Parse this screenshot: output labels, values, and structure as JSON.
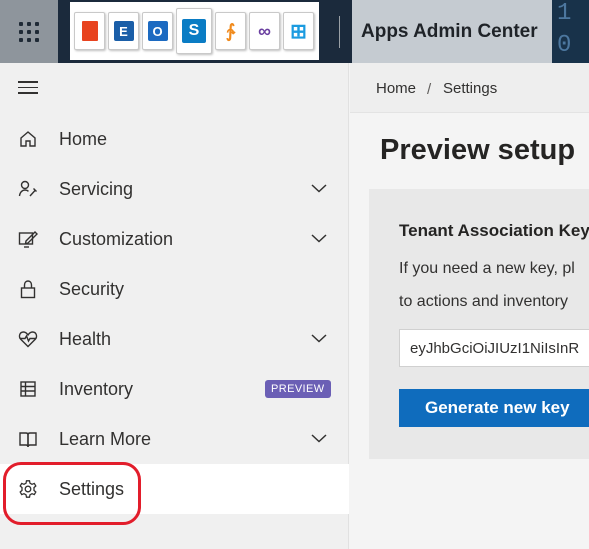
{
  "header": {
    "app_title": "Apps Admin Center",
    "waffle_icon": "app-launcher-icon",
    "logo_tiles": [
      {
        "icon": "office-icon",
        "letter": "",
        "color": "#e8431f"
      },
      {
        "icon": "exchange-icon",
        "letter": "E",
        "color": "#1a5ea8"
      },
      {
        "icon": "outlook-icon",
        "letter": "O",
        "color": "#1c6ac1"
      },
      {
        "icon": "sharepoint-icon",
        "letter": "S",
        "color": "#0a7cc4"
      },
      {
        "icon": "squiggle-icon",
        "letter": "∱",
        "color": "#f08a1c"
      },
      {
        "icon": "visual-studio-icon",
        "letter": "∞",
        "color": "#6a3fa0"
      },
      {
        "icon": "windows-icon",
        "letter": "⊞",
        "color": "#1a9be0"
      }
    ],
    "deco_digits": [
      "1",
      "0"
    ]
  },
  "sidebar": {
    "menu_icon": "hamburger-icon",
    "items": [
      {
        "label": "Home",
        "icon": "home-icon",
        "expandable": false
      },
      {
        "label": "Servicing",
        "icon": "wrench-person-icon",
        "expandable": true
      },
      {
        "label": "Customization",
        "icon": "edit-screen-icon",
        "expandable": true
      },
      {
        "label": "Security",
        "icon": "lock-icon",
        "expandable": false
      },
      {
        "label": "Health",
        "icon": "heart-pulse-icon",
        "expandable": true
      },
      {
        "label": "Inventory",
        "icon": "table-icon",
        "expandable": false,
        "badge": "PREVIEW"
      },
      {
        "label": "Learn More",
        "icon": "book-icon",
        "expandable": true
      },
      {
        "label": "Settings",
        "icon": "gear-icon",
        "expandable": false,
        "active": true
      }
    ]
  },
  "breadcrumb": {
    "home": "Home",
    "separator": "/",
    "current": "Settings"
  },
  "main": {
    "title": "Preview setup",
    "card": {
      "heading": "Tenant Association Key",
      "text_line1": "If you need a new key, pl",
      "text_line2": "to actions and inventory",
      "key_value": "eyJhbGciOiJIUzI1NiIsInR",
      "generate_button": "Generate new key"
    }
  },
  "colors": {
    "badge": "#6b5fb5",
    "primary_button": "#0f6cbd",
    "highlight_ring": "#e21d2b",
    "topbar": "#1b2a3c"
  }
}
